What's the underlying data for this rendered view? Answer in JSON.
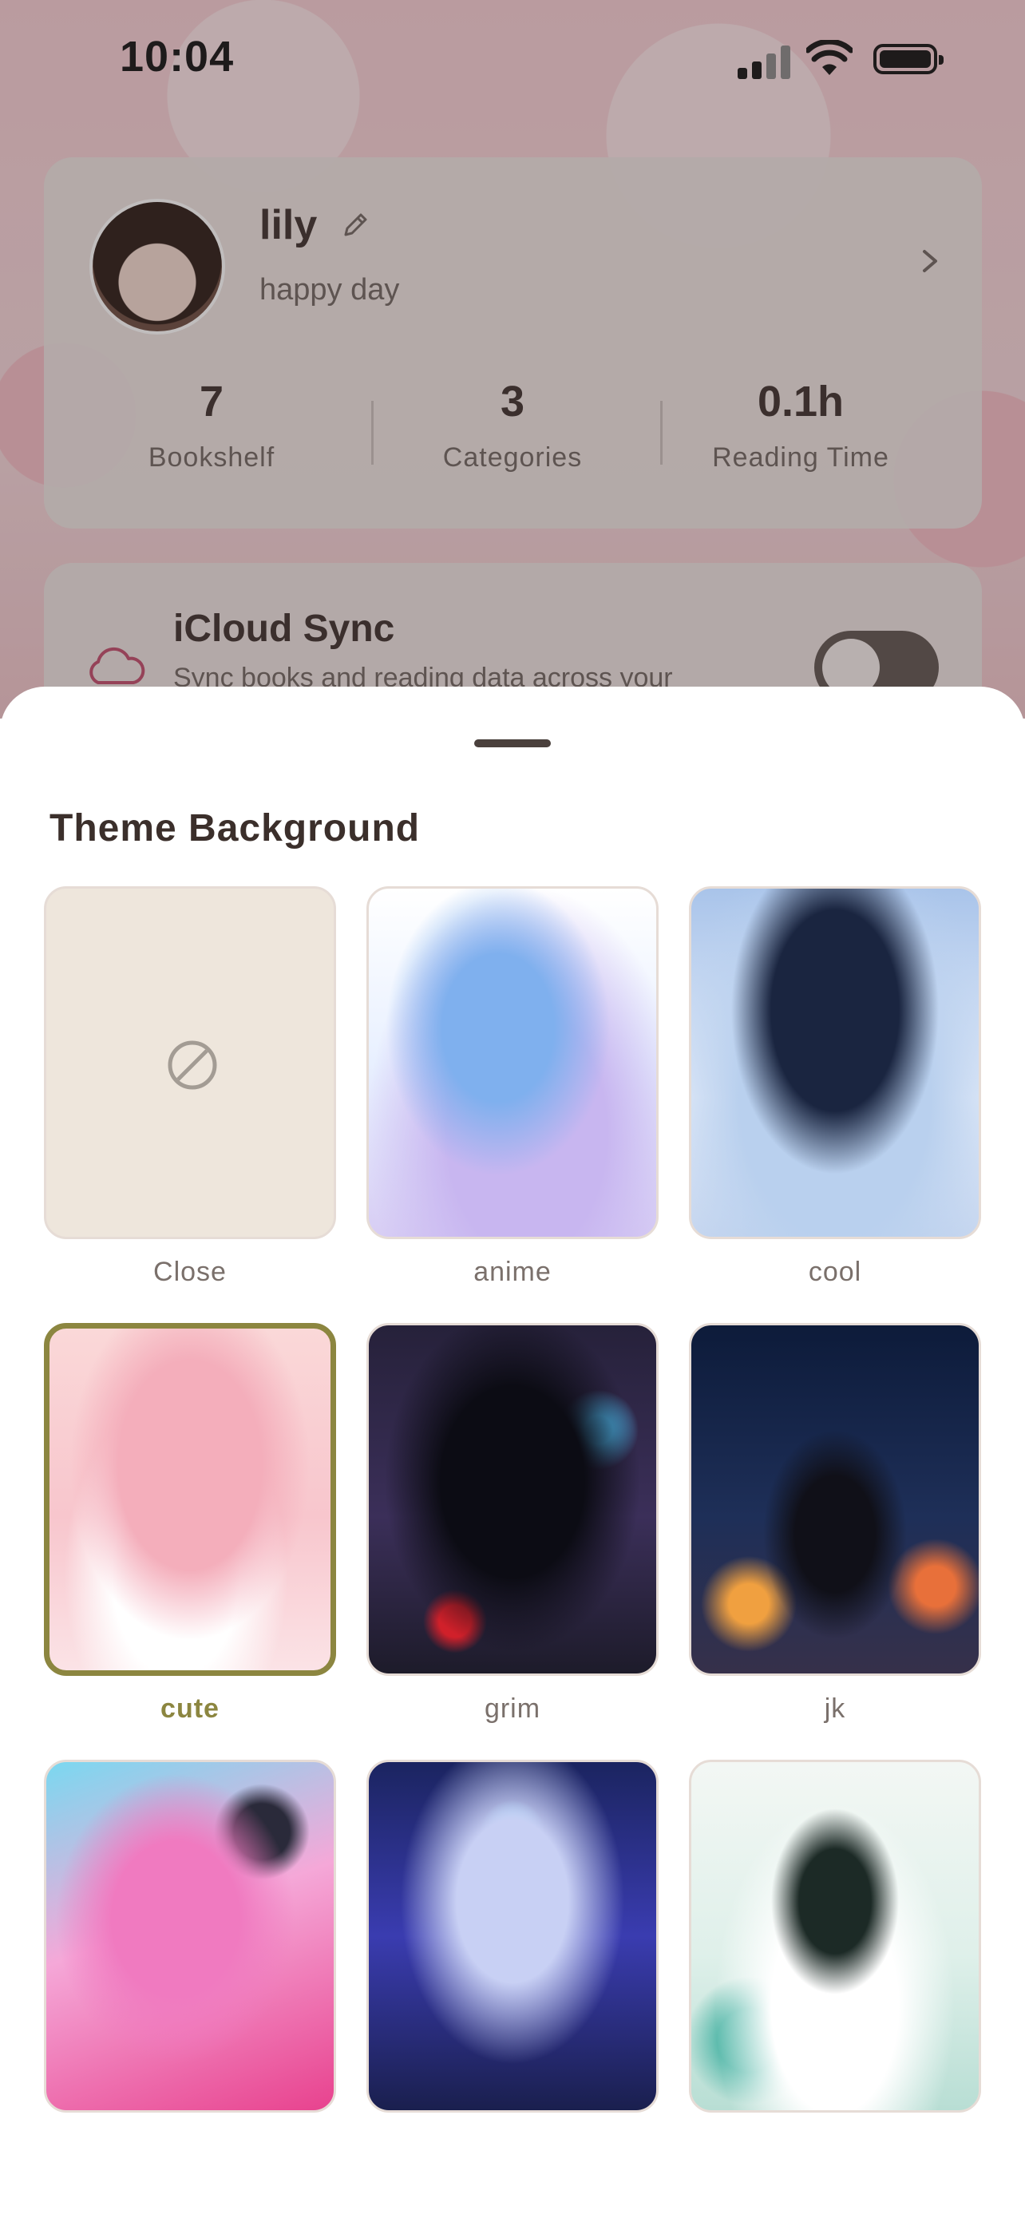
{
  "status_bar": {
    "time": "10:04"
  },
  "profile": {
    "name": "lily",
    "motto": "happy day",
    "stats": [
      {
        "value": "7",
        "label": "Bookshelf"
      },
      {
        "value": "3",
        "label": "Categories"
      },
      {
        "value": "0.1h",
        "label": "Reading Time"
      }
    ]
  },
  "sync": {
    "title": "iCloud Sync",
    "description": "Sync books and reading data across your",
    "enabled": false
  },
  "sheet": {
    "title": "Theme Background",
    "selected": "cute",
    "themes": [
      {
        "label": "Close",
        "icon": "ban-icon"
      },
      {
        "label": "anime"
      },
      {
        "label": "cool"
      },
      {
        "label": "cute"
      },
      {
        "label": "grim"
      },
      {
        "label": "jk"
      },
      {
        "label": ""
      },
      {
        "label": ""
      },
      {
        "label": ""
      }
    ]
  },
  "colors": {
    "accent": "#8c8640",
    "text_primary": "#3b2f2b",
    "text_secondary": "#7a706b"
  }
}
